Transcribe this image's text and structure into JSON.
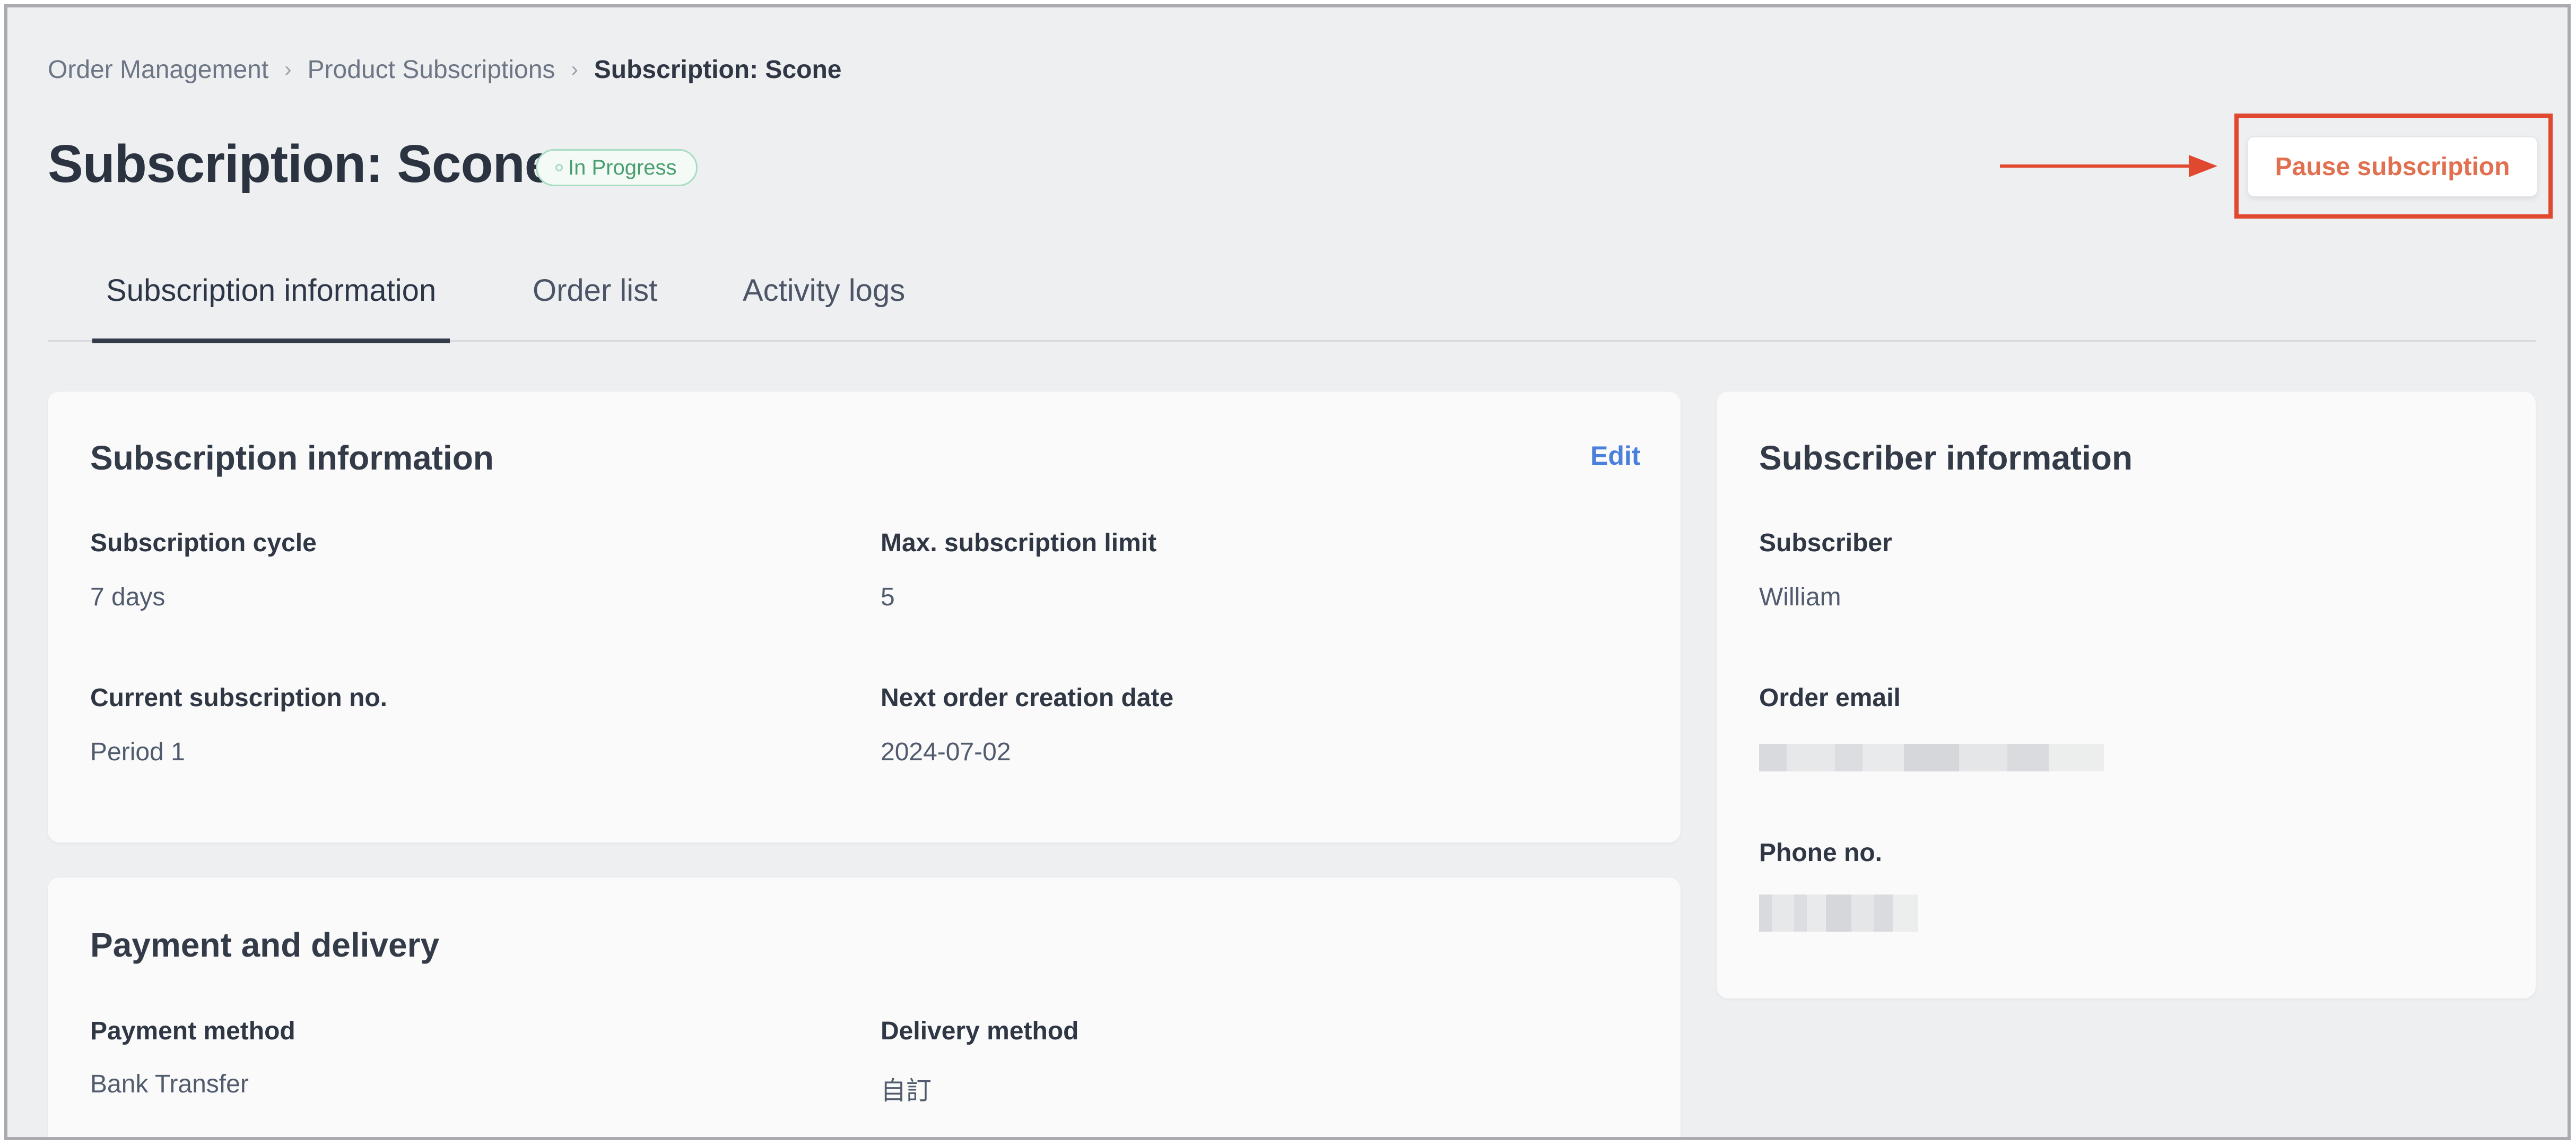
{
  "breadcrumb": {
    "items": [
      "Order Management",
      "Product Subscriptions",
      "Subscription: Scone"
    ],
    "separator": "›"
  },
  "header": {
    "title": "Subscription: Scone",
    "status": "In Progress",
    "pause_label": "Pause subscription"
  },
  "tabs": [
    "Subscription information",
    "Order list",
    "Activity logs"
  ],
  "subscription_info": {
    "title": "Subscription information",
    "edit_label": "Edit",
    "cycle_label": "Subscription cycle",
    "cycle_value": "7 days",
    "limit_label": "Max. subscription limit",
    "limit_value": "5",
    "current_no_label": "Current subscription no.",
    "current_no_value": "Period 1",
    "next_date_label": "Next order creation date",
    "next_date_value": "2024-07-02"
  },
  "payment_delivery": {
    "title": "Payment and delivery",
    "payment_label": "Payment method",
    "payment_value": "Bank Transfer",
    "delivery_label": "Delivery method",
    "delivery_value": "自訂"
  },
  "subscriber_info": {
    "title": "Subscriber information",
    "subscriber_label": "Subscriber",
    "subscriber_value": "William",
    "email_label": "Order email",
    "phone_label": "Phone no."
  },
  "colors": {
    "accent_red": "#e0492f",
    "status_green": "#4a9e6f",
    "link_blue": "#4a7fdc"
  }
}
